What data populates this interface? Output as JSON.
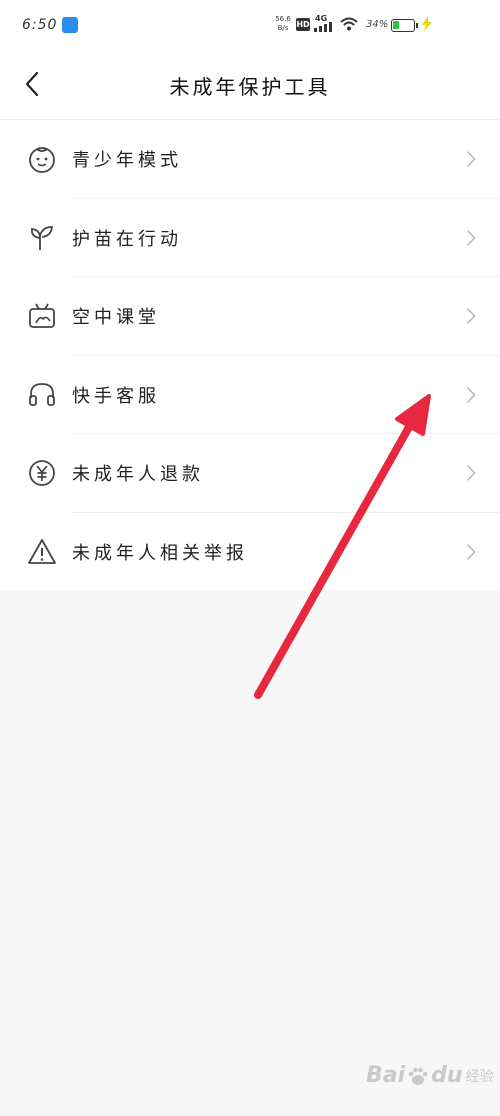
{
  "status_bar": {
    "time": "6:50",
    "speed_value": "56.6",
    "speed_unit": "B/s",
    "hd_label": "HD",
    "network_label": "4G",
    "battery_percent": "34%",
    "battery_level": 0.34
  },
  "header": {
    "title": "未成年保护工具"
  },
  "menu": {
    "items": [
      {
        "label": "青少年模式",
        "icon": "child-face-icon"
      },
      {
        "label": "护苗在行动",
        "icon": "sprout-icon"
      },
      {
        "label": "空中课堂",
        "icon": "tv-class-icon"
      },
      {
        "label": "快手客服",
        "icon": "headset-icon"
      },
      {
        "label": "未成年人退款",
        "icon": "yuan-coin-icon"
      },
      {
        "label": "未成年人相关举报",
        "icon": "warning-icon"
      }
    ]
  },
  "watermark": {
    "brand_left": "Bai",
    "brand_right": "du",
    "sub": "经验"
  },
  "colors": {
    "annotation_arrow": "#e8283f",
    "battery_fill": "#2cc63b",
    "app_icon": "#2a8ef0"
  }
}
